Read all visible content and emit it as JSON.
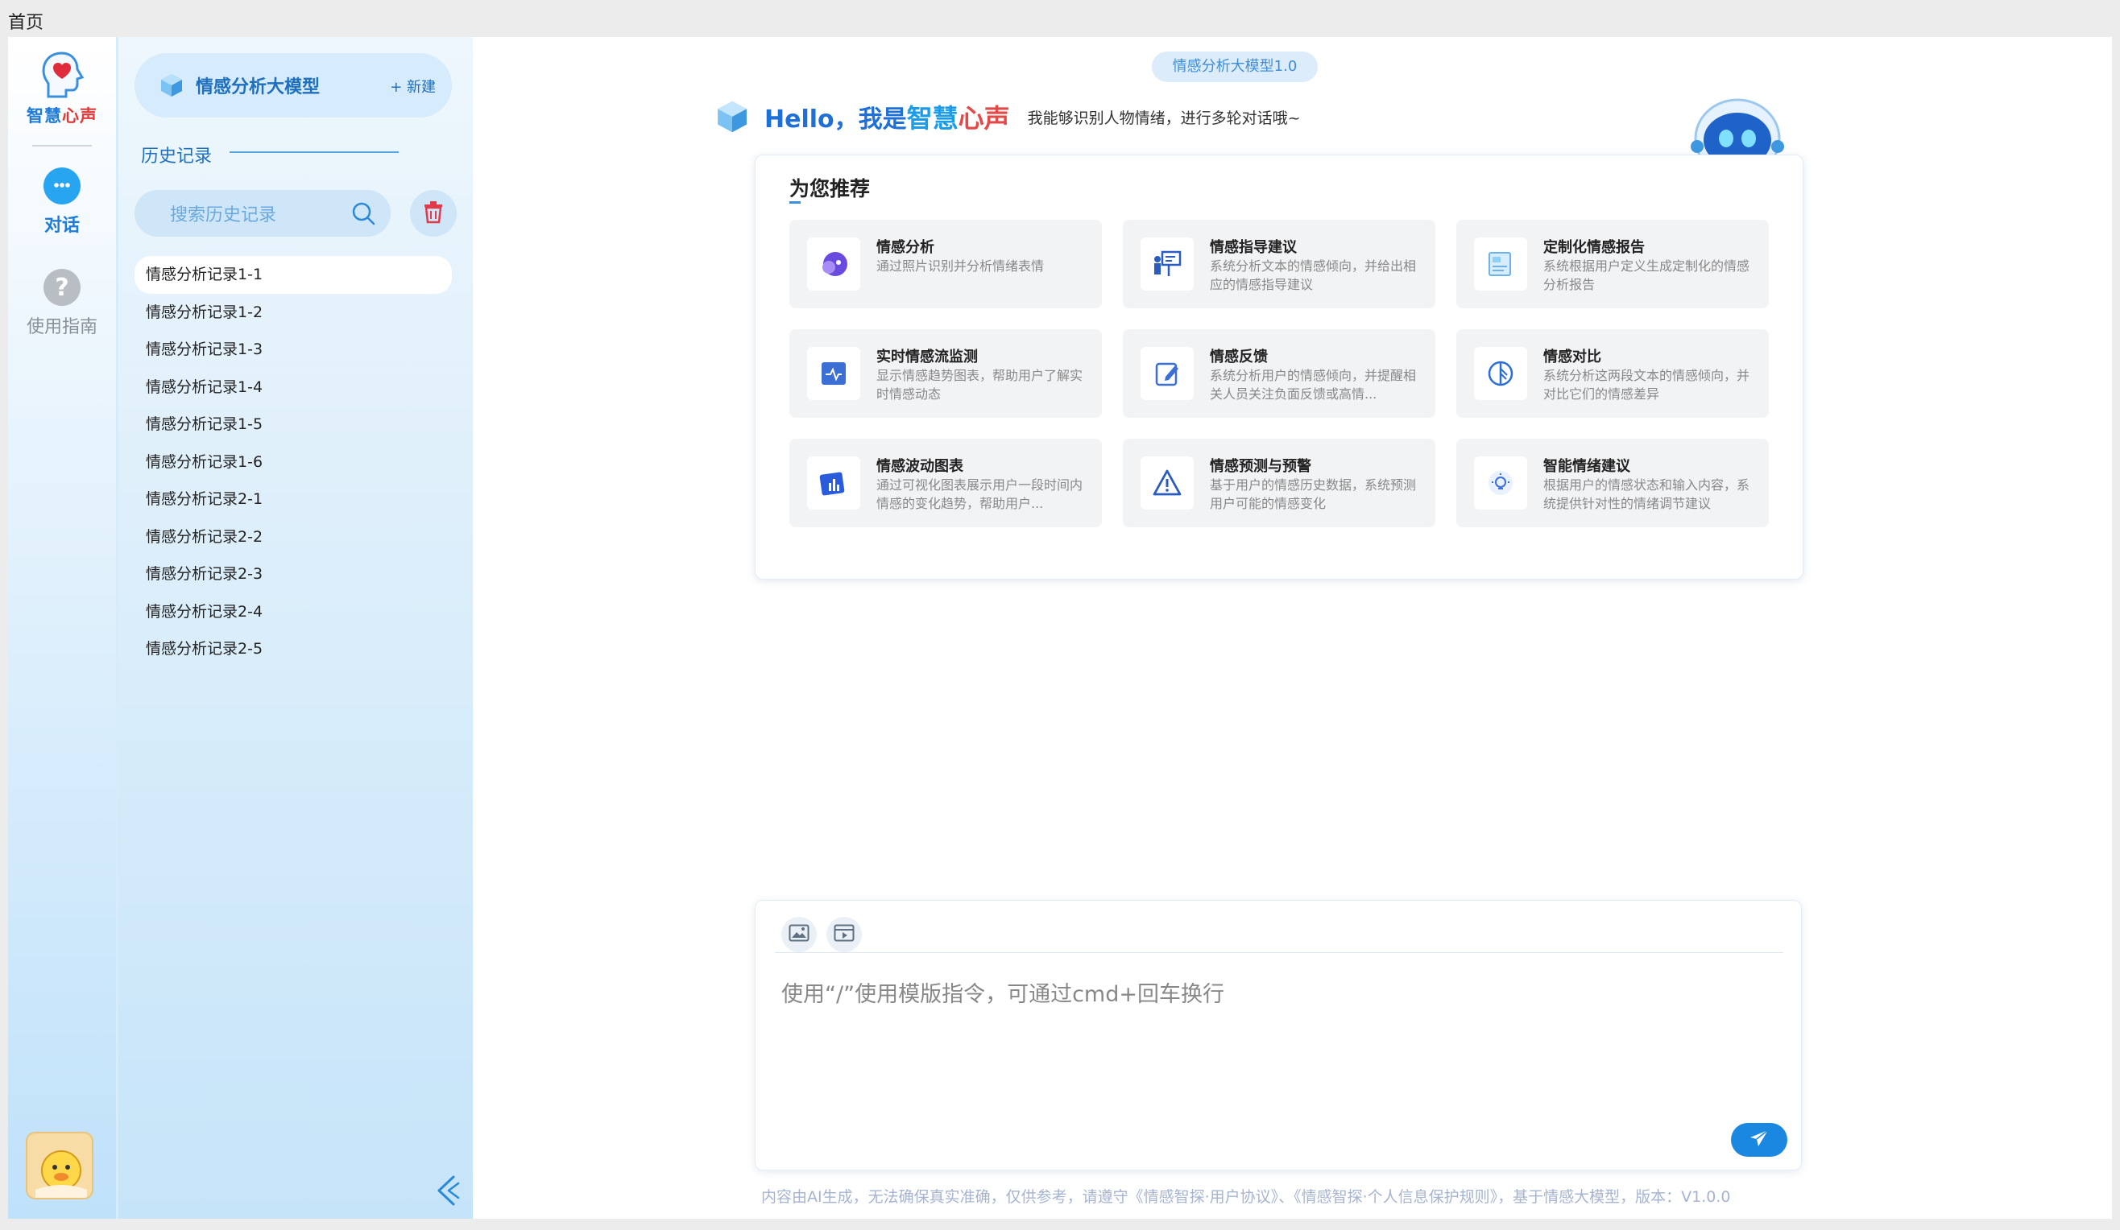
{
  "topbar": {
    "home": "首页"
  },
  "rail": {
    "logo_text_a": "智慧",
    "logo_text_b": "心声",
    "chat_label": "对话",
    "guide_label": "使用指南",
    "guide_glyph": "?"
  },
  "panel": {
    "model_name": "情感分析大模型",
    "new_label": "+ 新建",
    "history_title": "历史记录",
    "search_placeholder": "搜索历史记录",
    "items": [
      "情感分析记录1-1",
      "情感分析记录1-2",
      "情感分析记录1-3",
      "情感分析记录1-4",
      "情感分析记录1-5",
      "情感分析记录1-6",
      "情感分析记录2-1",
      "情感分析记录2-2",
      "情感分析记录2-3",
      "情感分析记录2-4",
      "情感分析记录2-5"
    ]
  },
  "main": {
    "version_badge": "情感分析大模型1.0",
    "hello_prefix": "Hello，我是",
    "brand_a": "智慧",
    "brand_b": "心声",
    "hello_sub": "我能够识别人物情绪，进行多轮对话哦~",
    "rec_title": "为您推荐",
    "recommendations": [
      {
        "title": "情感分析",
        "desc": "通过照片识别并分析情绪表情",
        "icon": "face-emotion-icon"
      },
      {
        "title": "情感指导建议",
        "desc": "系统分析文本的情感倾向，并给出相应的情感指导建议",
        "icon": "presenter-icon"
      },
      {
        "title": "定制化情感报告",
        "desc": "系统根据用户定义生成定制化的情感分析报告",
        "icon": "report-icon"
      },
      {
        "title": "实时情感流监测",
        "desc": "显示情感趋势图表，帮助用户了解实时情感动态",
        "icon": "monitor-icon"
      },
      {
        "title": "情感反馈",
        "desc": "系统分析用户的情感倾向，并提醒相关人员关注负面反馈或高情...",
        "icon": "edit-icon"
      },
      {
        "title": "情感对比",
        "desc": "系统分析这两段文本的情感倾向，并对比它们的情感差异",
        "icon": "compare-icon"
      },
      {
        "title": "情感波动图表",
        "desc": "通过可视化图表展示用户一段时间内情感的变化趋势，帮助用户...",
        "icon": "bar-chart-icon"
      },
      {
        "title": "情感预测与预警",
        "desc": "基于用户的情感历史数据，系统预测用户可能的情感变化",
        "icon": "warning-icon"
      },
      {
        "title": "智能情绪建议",
        "desc": "根据用户的情感状态和输入内容，系统提供针对性的情绪调节建议",
        "icon": "bulb-icon"
      }
    ],
    "input_placeholder": "使用“/”使用模版指令，可通过cmd+回车换行",
    "footer_note": "内容由AI生成，无法确保真实准确，仅供参考，请遵守《情感智探·用户协议》、《情感智探·个人信息保护规则》，基于情感大模型，版本：V1.0.0"
  },
  "colors": {
    "accent": "#1a87e0",
    "brand_red": "#e24a4a",
    "panel_bg": "#e0f0fb"
  }
}
